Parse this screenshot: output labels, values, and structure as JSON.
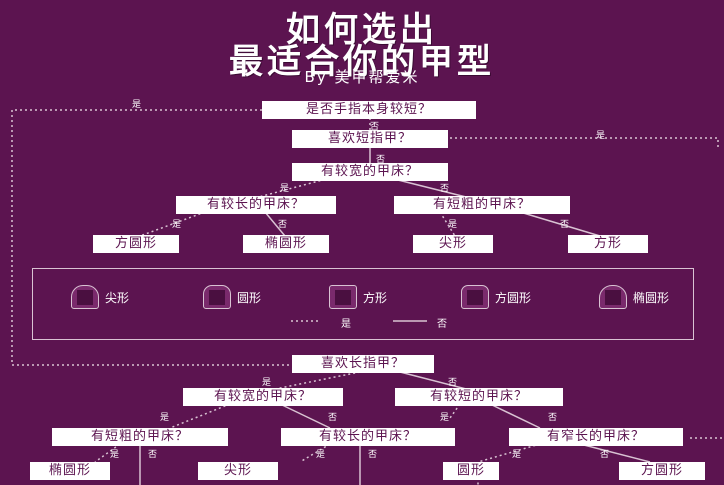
{
  "title": {
    "line1": "如何选出",
    "line2": "最适合你的甲型",
    "byline": "By 美甲帮爱米"
  },
  "labels": {
    "yes": "是",
    "no": "否"
  },
  "nodes": {
    "q_own_short": "是否手指本身较短？",
    "q_like_short": "喜欢短指甲？",
    "q_wider": "有较宽的甲床？",
    "q_longer_1": "有较长的甲床？",
    "q_shorter_thicker_1": "有短粗的甲床？",
    "r_square_round_1": "方圆形",
    "r_oval_1": "椭圆形",
    "r_pointed_1": "尖形",
    "r_square_1": "方形",
    "q_like_long": "喜欢长指甲？",
    "q_wider_2": "有较宽的甲床？",
    "q_shorter_2": "有较短的甲床？",
    "q_shorter_thicker_2": "有短粗的甲床？",
    "q_longer_2": "有较长的甲床？",
    "q_narrower": "有窄长的甲床？",
    "r_oval_2": "椭圆形",
    "r_pointed_2": "尖形",
    "r_round_2": "圆形",
    "r_square_round_2": "方圆形"
  },
  "legend": {
    "shapes": [
      "尖形",
      "圆形",
      "方形",
      "方圆形",
      "椭圆形"
    ],
    "yes_key": "是",
    "no_key": "否"
  },
  "colors": {
    "background": "#5c1450",
    "box": "#ffffff",
    "box_text": "#5c1450",
    "line": "#d9c3d3"
  }
}
